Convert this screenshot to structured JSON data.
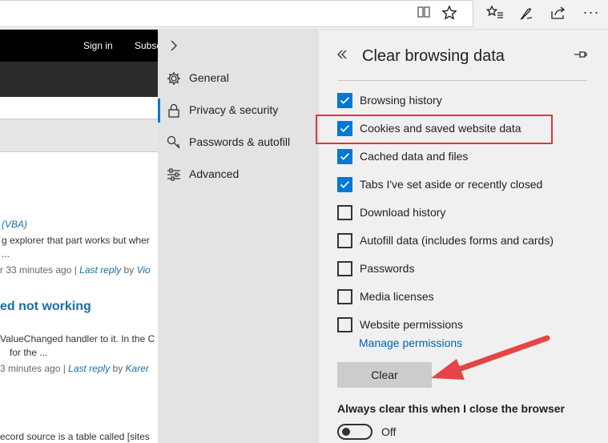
{
  "web_page": {
    "header_links": [
      "Sign in",
      "Subsc"
    ],
    "thread1": {
      "tag": "(VBA)",
      "excerpt_1": "g explorer that part works but wher",
      "excerpt_2": "...",
      "meta_time": "r 33 minutes ago | ",
      "meta_last_reply": "Last reply",
      "meta_by": " by ",
      "meta_user": "Vio"
    },
    "thread2": {
      "title": "ed not working",
      "excerpt_1": "ValueChanged handler to it. In the C",
      "excerpt_2": "for the ...",
      "meta_time": "3 minutes ago | ",
      "meta_last_reply": "Last reply",
      "meta_by": " by ",
      "meta_user": "Karer"
    },
    "thread3": {
      "excerpt_1": "ecord source is a table called [sites"
    }
  },
  "settings_nav": {
    "items": [
      {
        "label": "General",
        "icon": "gear-icon"
      },
      {
        "label": "Privacy & security",
        "icon": "lock-icon"
      },
      {
        "label": "Passwords & autofill",
        "icon": "key-icon"
      },
      {
        "label": "Advanced",
        "icon": "sliders-icon"
      }
    ],
    "active": "Privacy & security"
  },
  "flyout": {
    "title": "Clear browsing data",
    "options": [
      {
        "label": "Browsing history",
        "checked": true
      },
      {
        "label": "Cookies and saved website data",
        "checked": true
      },
      {
        "label": "Cached data and files",
        "checked": true
      },
      {
        "label": "Tabs I've set aside or recently closed",
        "checked": true
      },
      {
        "label": "Download history",
        "checked": false
      },
      {
        "label": "Autofill data (includes forms and cards)",
        "checked": false
      },
      {
        "label": "Passwords",
        "checked": false
      },
      {
        "label": "Media licenses",
        "checked": false
      },
      {
        "label": "Website permissions",
        "checked": false
      }
    ],
    "manage_permissions_link": "Manage permissions",
    "clear_button": "Clear",
    "always_clear_heading": "Always clear this when I close the browser",
    "toggle_state": "Off"
  },
  "colors": {
    "accent": "#0078d7",
    "highlight_box": "#e0363b",
    "arrow": "#e54545",
    "nav_pane_bg": "#e3e3e3",
    "flyout_bg": "#f0f0f0"
  }
}
